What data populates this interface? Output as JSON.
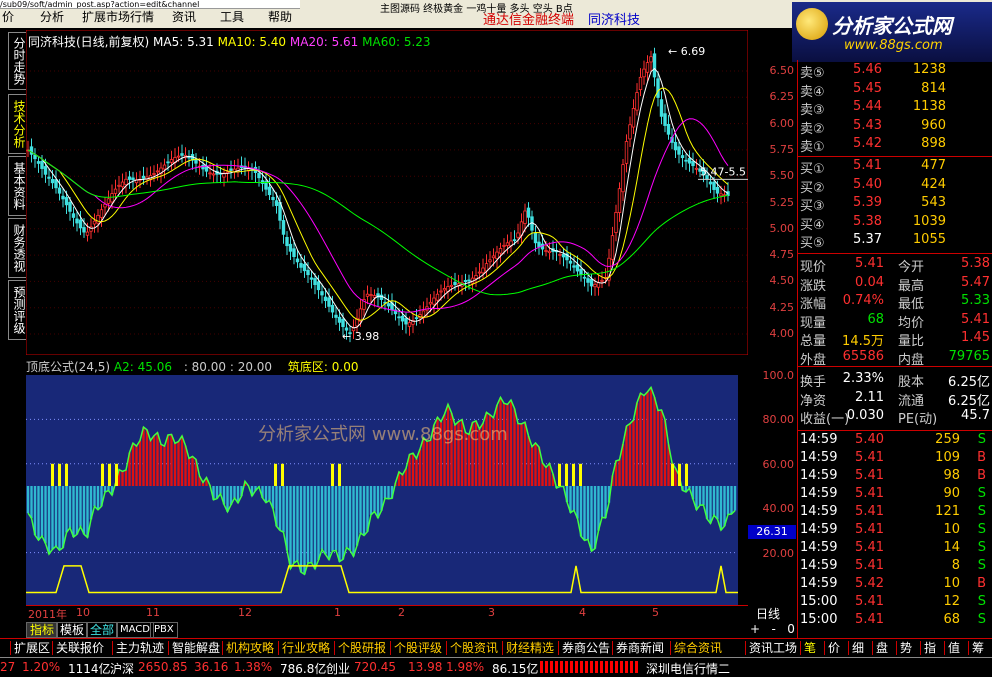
{
  "menu": {
    "url": "/sub09/soft/admin_post.asp?action=edit&channel",
    "items": [
      "价",
      "分析",
      "扩展市场行情",
      "资讯",
      "工具",
      "帮助"
    ],
    "extra": "主图源码  终极黄金  一鸡十量  多头  空头  B点",
    "brand_left": "通达信金融终端",
    "brand_right": "同济科技"
  },
  "logo": {
    "title": "分析家公式网",
    "url": "www.88gs.com"
  },
  "left_tabs": [
    "分时走势",
    "技术分析",
    "基本资料",
    "财务透视",
    "预测评级"
  ],
  "main_chart": {
    "header": {
      "name": "同济科技(日线,前复权)",
      "ma5": "MA5: 5.31",
      "ma10": "MA10: 5.40",
      "ma20": "MA20: 5.61",
      "ma60": "MA60: 5.23"
    },
    "price_ticks": [
      "6.50",
      "6.25",
      "6.00",
      "5.75",
      "5.50",
      "5.25",
      "5.00",
      "4.75",
      "4.50",
      "4.25",
      "4.00"
    ],
    "high_label": "6.69",
    "low_label": "3.98",
    "cursor_label": "5.47-5.5",
    "colors": {
      "ma5": "#ffffff",
      "ma10": "#ffff00",
      "ma20": "#ff00ff",
      "ma60": "#00ff00",
      "up": "#ff3030",
      "down": "#40e0e0"
    }
  },
  "indicator": {
    "header": {
      "name": "顶底公式(24,5)",
      "a2": "A2: 45.06",
      "range": ": 80.00 : 20.00",
      "zone": "筑底区: 0.00"
    },
    "ticks": [
      "100.0",
      "80.00",
      "60.00",
      "40.00",
      "20.00"
    ],
    "cursor_value": "26.31",
    "watermark": "分析家公式网  www.88gs.com"
  },
  "date_axis": {
    "labels": [
      "2011年",
      "10",
      "11",
      "12",
      "1",
      "2",
      "3",
      "4",
      "5"
    ],
    "period": "日线"
  },
  "order_book": {
    "sell": [
      {
        "label": "卖⑤",
        "price": "5.46",
        "vol": "1238"
      },
      {
        "label": "卖④",
        "price": "5.45",
        "vol": "814"
      },
      {
        "label": "卖③",
        "price": "5.44",
        "vol": "1138"
      },
      {
        "label": "卖②",
        "price": "5.43",
        "vol": "960"
      },
      {
        "label": "卖①",
        "price": "5.42",
        "vol": "898"
      }
    ],
    "buy": [
      {
        "label": "买①",
        "price": "5.41",
        "vol": "477"
      },
      {
        "label": "买②",
        "price": "5.40",
        "vol": "424"
      },
      {
        "label": "买③",
        "price": "5.39",
        "vol": "543"
      },
      {
        "label": "买④",
        "price": "5.38",
        "vol": "1039"
      },
      {
        "label": "买⑤",
        "price": "5.37",
        "vol": "1055"
      }
    ]
  },
  "quote": [
    {
      "k1": "现价",
      "v1": "5.41",
      "k2": "今开",
      "v2": "5.38"
    },
    {
      "k1": "涨跌",
      "v1": "0.04",
      "k2": "最高",
      "v2": "5.47"
    },
    {
      "k1": "涨幅",
      "v1": "0.74%",
      "k2": "最低",
      "v2": "5.33"
    },
    {
      "k1": "现量",
      "v1": "68",
      "k2": "均价",
      "v2": "5.41"
    },
    {
      "k1": "总量",
      "v1": "14.5万",
      "k2": "量比",
      "v2": "1.45"
    },
    {
      "k1": "外盘",
      "v1": "65586",
      "k2": "内盘",
      "v2": "79765"
    },
    {
      "k1": "换手",
      "v1": "2.33%",
      "k2": "股本",
      "v2": "6.25亿"
    },
    {
      "k1": "净资",
      "v1": "2.11",
      "k2": "流通",
      "v2": "6.25亿"
    },
    {
      "k1": "收益(一)",
      "v1": "0.030",
      "k2": "PE(动)",
      "v2": "45.7"
    }
  ],
  "ticks": [
    {
      "t": "14:59",
      "p": "5.40",
      "v": "259",
      "s": "S"
    },
    {
      "t": "14:59",
      "p": "5.41",
      "v": "109",
      "s": "B"
    },
    {
      "t": "14:59",
      "p": "5.41",
      "v": "98",
      "s": "B"
    },
    {
      "t": "14:59",
      "p": "5.41",
      "v": "90",
      "s": "S"
    },
    {
      "t": "14:59",
      "p": "5.41",
      "v": "121",
      "s": "S"
    },
    {
      "t": "14:59",
      "p": "5.41",
      "v": "10",
      "s": "S"
    },
    {
      "t": "14:59",
      "p": "5.41",
      "v": "14",
      "s": "S"
    },
    {
      "t": "14:59",
      "p": "5.41",
      "v": "8",
      "s": "S"
    },
    {
      "t": "14:59",
      "p": "5.42",
      "v": "10",
      "s": "B"
    },
    {
      "t": "15:00",
      "p": "5.41",
      "v": "12",
      "s": "S"
    },
    {
      "t": "15:00",
      "p": "5.41",
      "v": "68",
      "s": "S"
    }
  ],
  "tabs": [
    "指标",
    "模板",
    "全部",
    "MACD",
    "PBX"
  ],
  "func_tabs": [
    "扩展区",
    "关联报价",
    "主力轨迹",
    "智能解盘",
    "机构攻略",
    "行业攻略",
    "个股研报",
    "个股评级",
    "个股资讯",
    "财经精选",
    "券商公告",
    "券商新闻",
    "综合资讯",
    "资讯工场"
  ],
  "right_tabs": [
    "笔",
    "价",
    "细",
    "盘",
    "势",
    "指",
    "值",
    "筹"
  ],
  "status": {
    "a": "27",
    "b": "1.20%",
    "c": "1114亿",
    "d": "沪深",
    "e": "2650.85",
    "f": "36.16",
    "g": "1.38%",
    "h": "786.8亿",
    "i": "创业",
    "j": "720.45",
    "k": "13.98",
    "l": "1.98%",
    "m": "86.15亿",
    "n": "深圳电信行情二"
  }
}
